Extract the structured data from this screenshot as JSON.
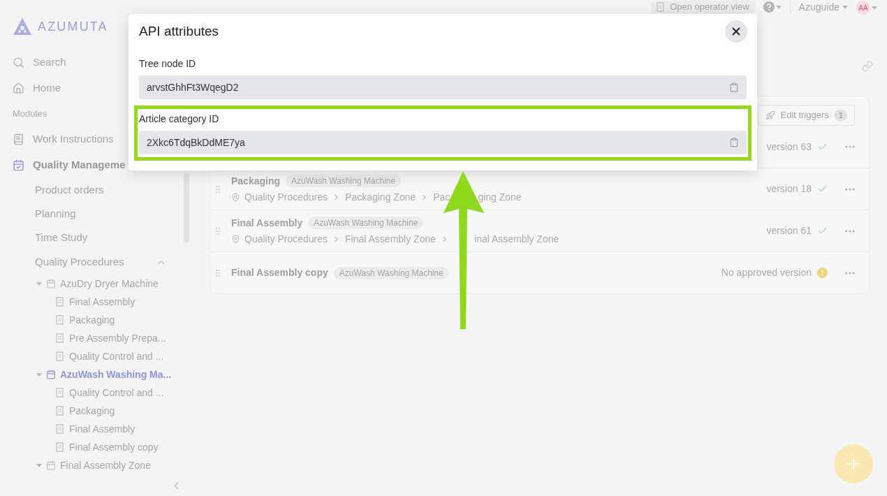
{
  "brand": "AZUMUTA",
  "topbar": {
    "operator_button": "Open operator view",
    "workspace": "Azuguide",
    "avatar": "AA"
  },
  "sidebar": {
    "search": "Search",
    "home": "Home",
    "section": "Modules",
    "modules": [
      {
        "label": "Work Instructions",
        "kind": "book",
        "selected": false
      },
      {
        "label": "Quality Manageme",
        "kind": "calendar",
        "selected": true
      }
    ],
    "subitems": [
      "Product orders",
      "Planning",
      "Time Study"
    ],
    "tree": {
      "label": "Quality Procedures",
      "expanded": true,
      "children": [
        {
          "label": "AzuDry Dryer Machine",
          "kind": "folder",
          "expanded": true,
          "selected": false,
          "children": [
            {
              "label": "Final Assembly",
              "kind": "document",
              "selected": false
            },
            {
              "label": "Packaging",
              "kind": "document",
              "selected": false
            },
            {
              "label": "Pre Assembly Prepa...",
              "kind": "document",
              "selected": false
            },
            {
              "label": "Quality Control and ...",
              "kind": "document",
              "selected": false
            }
          ]
        },
        {
          "label": "AzuWash Washing Ma...",
          "kind": "folder",
          "expanded": true,
          "selected": true,
          "children": [
            {
              "label": "Quality Control and ...",
              "kind": "document",
              "selected": false
            },
            {
              "label": "Packaging",
              "kind": "document",
              "selected": false
            },
            {
              "label": "Final Assembly",
              "kind": "document",
              "selected": false
            },
            {
              "label": "Final Assembly copy",
              "kind": "document",
              "selected": false
            }
          ]
        },
        {
          "label": "Final Assembly Zone",
          "kind": "folder",
          "expanded": true,
          "selected": false
        }
      ]
    }
  },
  "main": {
    "edit_triggers": {
      "label": "Edit triggers",
      "count": "1"
    },
    "rows": [
      {
        "status": "version 63",
        "approved": true
      },
      {
        "title": "Packaging",
        "tag": "AzuWash Washing Machine",
        "path": [
          "Quality Procedures",
          "Packaging Zone",
          "Pac"
        ],
        "path_after_arrow": "ging Zone",
        "arrow": true,
        "status": "version 18",
        "approved": true
      },
      {
        "title": "Final Assembly",
        "tag": "AzuWash Washing Machine",
        "path": [
          "Quality Procedures",
          "Final Assembly Zone"
        ],
        "path_after_arrow": "inal Assembly Zone",
        "arrow": false,
        "status": "version 61",
        "approved": true
      },
      {
        "title": "Final Assembly copy",
        "tag": "AzuWash Washing Machine",
        "status": "No approved version",
        "approved": false
      }
    ]
  },
  "dialog": {
    "title": "API attributes",
    "fields": [
      {
        "label": "Tree node ID",
        "value": "arvstGhhFt3WqegD2",
        "highlighted": false
      },
      {
        "label": "Article category ID",
        "value": "2Xkc6TdqBkDdME7ya",
        "highlighted": true
      }
    ]
  }
}
